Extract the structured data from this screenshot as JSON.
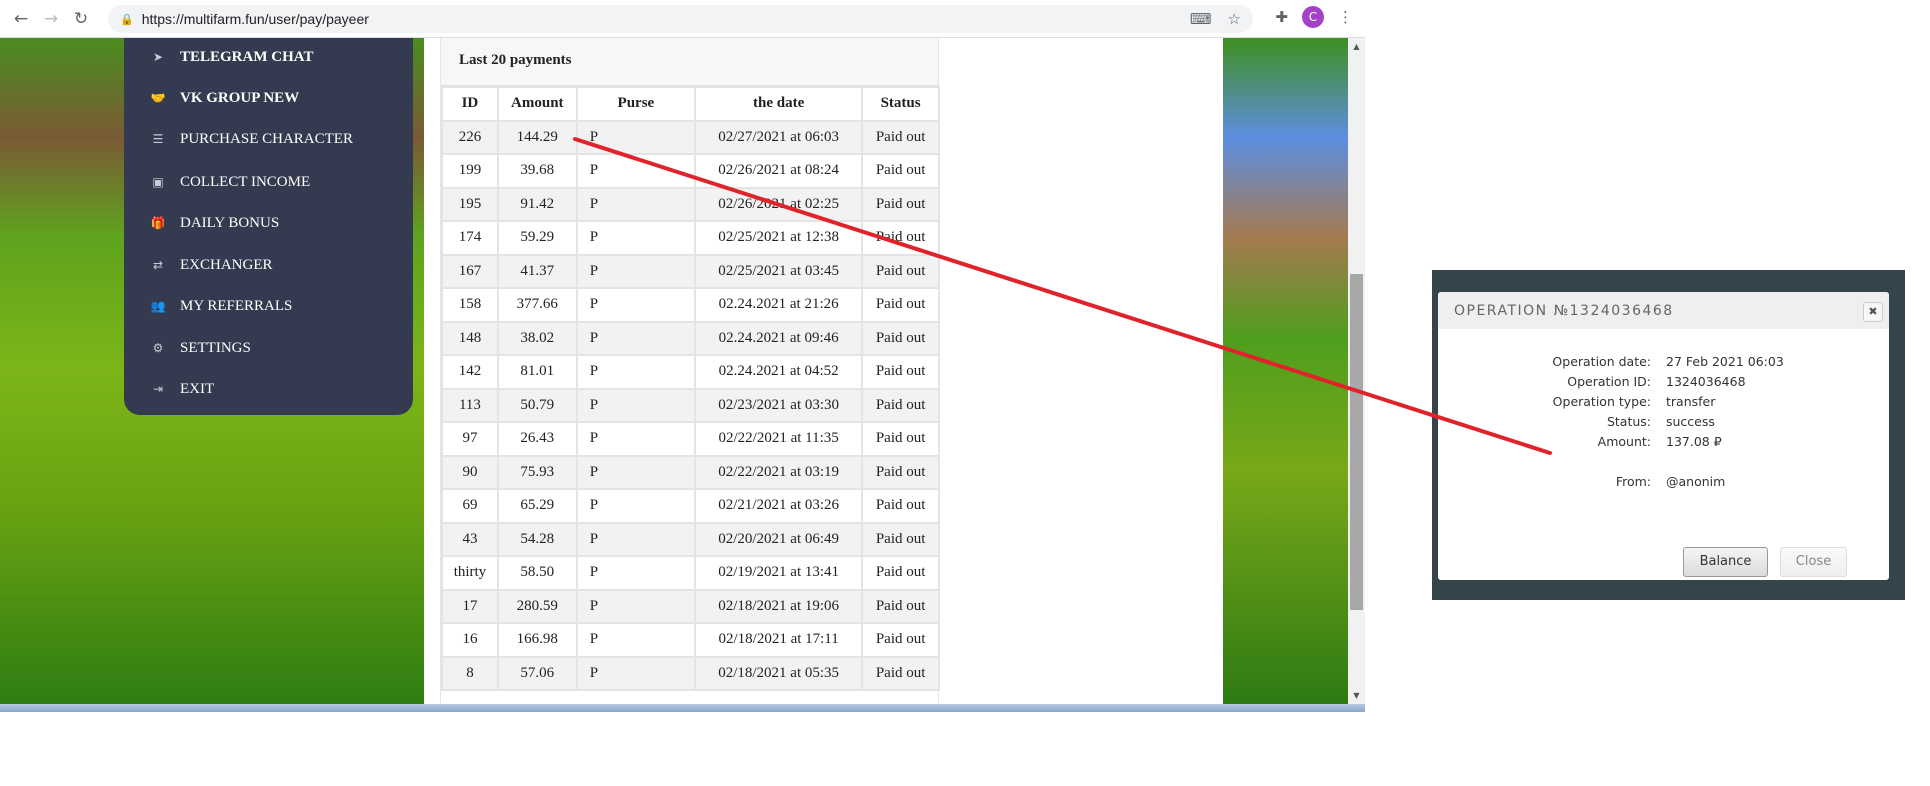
{
  "browser": {
    "url": "https://multifarm.fun/user/pay/payeer",
    "profile_initial": "C"
  },
  "sidebar": {
    "items": [
      {
        "label": "TELEGRAM CHAT",
        "icon": "paper-plane-icon",
        "glyph": "➤",
        "bold": true
      },
      {
        "label": "VK GROUP NEW",
        "icon": "handshake-icon",
        "glyph": "🤝",
        "bold": true
      },
      {
        "label": "PURCHASE CHARACTER",
        "icon": "list-icon",
        "glyph": "☰",
        "bold": false
      },
      {
        "label": "COLLECT INCOME",
        "icon": "money-icon",
        "glyph": "▣",
        "bold": false
      },
      {
        "label": "DAILY BONUS",
        "icon": "gift-icon",
        "glyph": "🎁",
        "bold": false
      },
      {
        "label": "EXCHANGER",
        "icon": "exchange-icon",
        "glyph": "⇄",
        "bold": false
      },
      {
        "label": "MY REFERRALS",
        "icon": "users-icon",
        "glyph": "👥",
        "bold": false
      },
      {
        "label": "SETTINGS",
        "icon": "gear-icon",
        "glyph": "⚙",
        "bold": false
      },
      {
        "label": "EXIT",
        "icon": "sign-out-icon",
        "glyph": "⇥",
        "bold": false
      }
    ]
  },
  "payments": {
    "title": "Last 20 payments",
    "columns": [
      "ID",
      "Amount",
      "Purse",
      "the date",
      "Status"
    ],
    "rows": [
      [
        "226",
        "144.29",
        "P",
        "02/27/2021 at 06:03",
        "Paid out"
      ],
      [
        "199",
        "39.68",
        "P",
        "02/26/2021 at 08:24",
        "Paid out"
      ],
      [
        "195",
        "91.42",
        "P",
        "02/26/2021 at 02:25",
        "Paid out"
      ],
      [
        "174",
        "59.29",
        "P",
        "02/25/2021 at 12:38",
        "Paid out"
      ],
      [
        "167",
        "41.37",
        "P",
        "02/25/2021 at 03:45",
        "Paid out"
      ],
      [
        "158",
        "377.66",
        "P",
        "02.24.2021 at 21:26",
        "Paid out"
      ],
      [
        "148",
        "38.02",
        "P",
        "02.24.2021 at 09:46",
        "Paid out"
      ],
      [
        "142",
        "81.01",
        "P",
        "02.24.2021 at 04:52",
        "Paid out"
      ],
      [
        "113",
        "50.79",
        "P",
        "02/23/2021 at 03:30",
        "Paid out"
      ],
      [
        "97",
        "26.43",
        "P",
        "02/22/2021 at 11:35",
        "Paid out"
      ],
      [
        "90",
        "75.93",
        "P",
        "02/22/2021 at 03:19",
        "Paid out"
      ],
      [
        "69",
        "65.29",
        "P",
        "02/21/2021 at 03:26",
        "Paid out"
      ],
      [
        "43",
        "54.28",
        "P",
        "02/20/2021 at 06:49",
        "Paid out"
      ],
      [
        "thirty",
        "58.50",
        "P",
        "02/19/2021 at 13:41",
        "Paid out"
      ],
      [
        "17",
        "280.59",
        "P",
        "02/18/2021 at 19:06",
        "Paid out"
      ],
      [
        "16",
        "166.98",
        "P",
        "02/18/2021 at 17:11",
        "Paid out"
      ],
      [
        "8",
        "57.06",
        "P",
        "02/18/2021 at 05:35",
        "Paid out"
      ]
    ]
  },
  "modal": {
    "title": "OPERATION №1324036468",
    "fields": [
      {
        "label": "Operation date:",
        "value": "27 Feb 2021 06:03"
      },
      {
        "label": "Operation ID:",
        "value": "1324036468"
      },
      {
        "label": "Operation type:",
        "value": "transfer"
      },
      {
        "label": "Status:",
        "value": "success"
      },
      {
        "label": "Amount:",
        "value": "137.08 ₽"
      },
      {
        "label": "From:",
        "value": "@anonim"
      }
    ],
    "balance_label": "Balance",
    "close_label": "Close"
  },
  "colors": {
    "sidebar": "#343a4f",
    "annotation_line": "#e0232b",
    "modal_backdrop": "#35444b"
  }
}
